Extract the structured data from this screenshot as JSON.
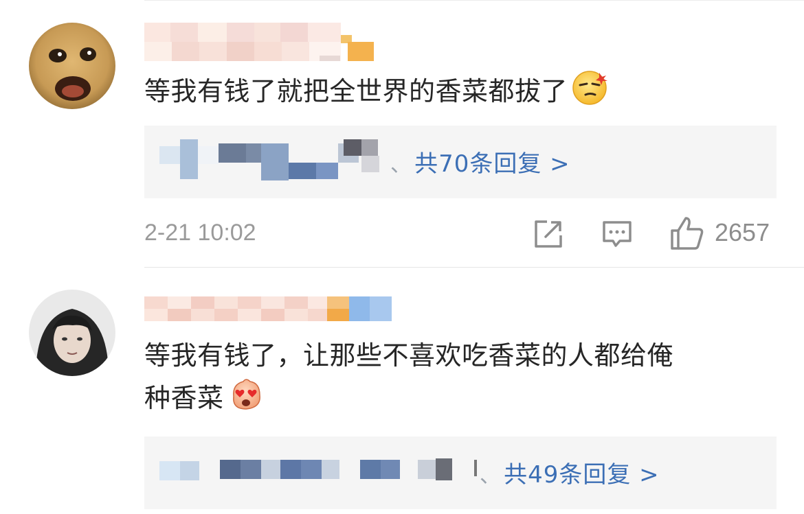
{
  "comments": [
    {
      "text": "等我有钱了就把全世界的香菜都拔了",
      "emoji_icon": "smug-emoji-icon",
      "replies": {
        "sep": "、",
        "link": "共70条回复 >"
      },
      "timestamp": "2-21 10:02",
      "like_count": "2657"
    },
    {
      "text_line1": "等我有钱了，让那些不喜欢吃香菜的人都给俺",
      "text_line2": "种香菜",
      "emoji_icon": "heart-eyes-emoji-icon",
      "replies": {
        "sep": "、",
        "link": "共49条回复 >"
      }
    }
  ],
  "colors": {
    "link": "#3c6fb5",
    "meta_gray": "#9a9a9a",
    "reply_bg": "#f5f5f5"
  }
}
